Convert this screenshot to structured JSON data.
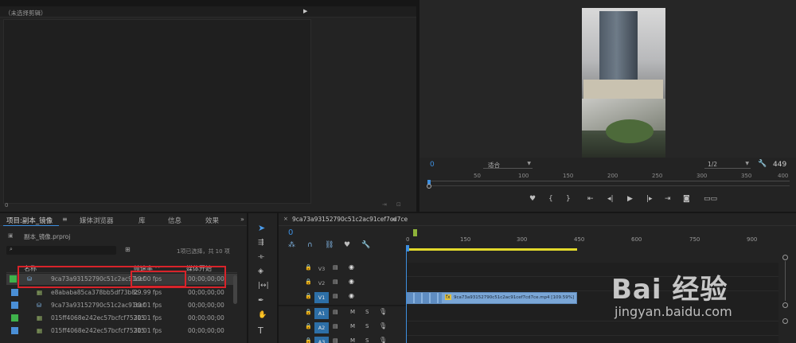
{
  "source": {
    "title": "（未选择剪辑）",
    "timecode": "0"
  },
  "program": {
    "timecode_left": "0",
    "fit_label": "适合",
    "resolution": "1/2",
    "duration": "449",
    "ruler": [
      "50",
      "100",
      "150",
      "200",
      "250",
      "300",
      "350",
      "400"
    ]
  },
  "project": {
    "tabs": [
      "项目:副本_镜像",
      "媒体浏览器",
      "库",
      "信息",
      "效果"
    ],
    "file_name": "副本_镜像.prproj",
    "selection_info": "1项已选择，共 10 项",
    "col_name": "名称",
    "col_fps": "帧速率 ^",
    "col_start": "媒体开始",
    "rows": [
      {
        "name": "9ca73a93152790c51c2ac91cef",
        "fps": "10.00 fps",
        "start": "00;00;00;00",
        "color": "#3fb24b"
      },
      {
        "name": "e8ababa85ca378bb5df73b8c",
        "fps": "29.99 fps",
        "start": "00;00;00;00",
        "color": "#4a8fd6"
      },
      {
        "name": "9ca73a93152790c51c2ac91cef",
        "fps": "30.01 fps",
        "start": "00;00;00;00",
        "color": "#4a8fd6"
      },
      {
        "name": "015ff4068e242ec57bcfcf75215",
        "fps": "30.01 fps",
        "start": "00;00;00;00",
        "color": "#3fb24b"
      },
      {
        "name": "015ff4068e242ec57bcfcf75215",
        "fps": "30.01 fps",
        "start": "00;00;00;00",
        "color": "#4a8fd6"
      }
    ]
  },
  "timeline": {
    "sequence_name": "9ca73a93152790c51c2ac91cef7cd7ce",
    "timecode": "0",
    "ruler": [
      "0",
      "150",
      "300",
      "450",
      "600",
      "750",
      "900"
    ],
    "tracks": [
      "V3",
      "V2",
      "V1",
      "A1",
      "A2",
      "A3"
    ],
    "clip_label": "9ca73a93152790c51c2ac91cef7cd7ce.mp4 [109.59%]",
    "fx": "fx",
    "mute": "M",
    "solo": "S"
  },
  "watermark": {
    "brand": "Bai 经验",
    "url": "jingyan.baidu.com"
  }
}
